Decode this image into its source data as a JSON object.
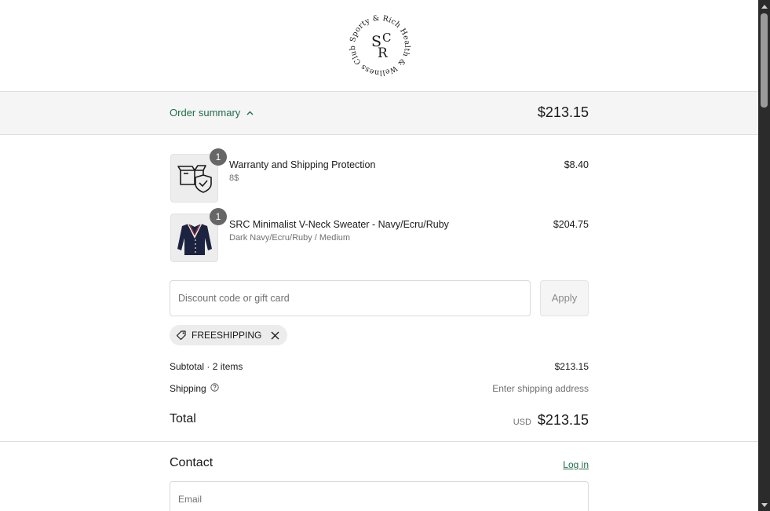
{
  "brand": {
    "logo_initials": "SRC",
    "logo_ring_text": "Sporty & Rich Health & Wellness Club"
  },
  "summary_bar": {
    "toggle_label": "Order summary",
    "total": "$213.15"
  },
  "line_items": [
    {
      "quantity": "1",
      "title": "Warranty and Shipping Protection",
      "variant": "8$",
      "price": "$8.40",
      "thumbnail_icon": "package-shield-icon"
    },
    {
      "quantity": "1",
      "title": "SRC Minimalist V-Neck Sweater - Navy/Ecru/Ruby",
      "variant": "Dark Navy/Ecru/Ruby / Medium",
      "price": "$204.75",
      "thumbnail_icon": "sweater-image"
    }
  ],
  "discount": {
    "placeholder": "Discount code or gift card",
    "apply_label": "Apply",
    "applied_code": "FREESHIPPING"
  },
  "totals": {
    "subtotal_label": "Subtotal · 2 items",
    "subtotal_value": "$213.15",
    "shipping_label": "Shipping",
    "shipping_value": "Enter shipping address",
    "total_label": "Total",
    "currency": "USD",
    "total_value": "$213.15"
  },
  "contact": {
    "heading": "Contact",
    "login_label": "Log in",
    "email_placeholder": "Email"
  },
  "colors": {
    "accent_green": "#1f6e4a",
    "summary_bg": "#f5f5f5",
    "badge_gray": "#666666",
    "navy": "#1c2340",
    "ruby": "#8b1e2e"
  }
}
